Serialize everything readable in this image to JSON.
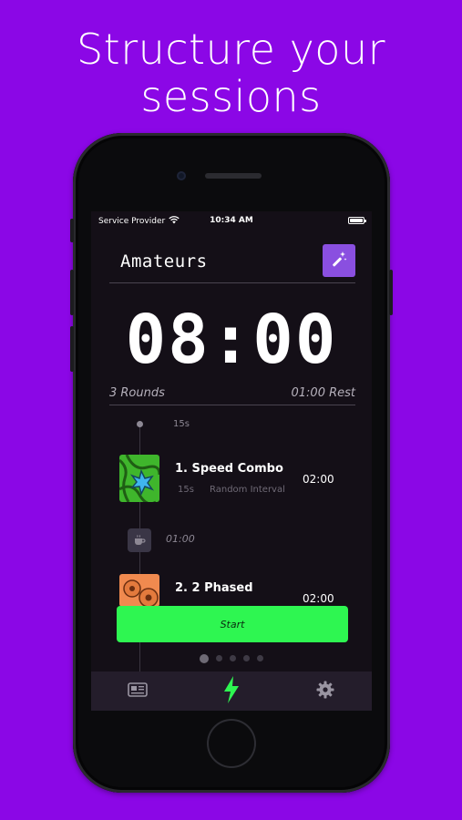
{
  "headline": {
    "line1": "Structure your",
    "line2": "sessions"
  },
  "status_bar": {
    "carrier": "Service Provider",
    "time": "10:34 AM"
  },
  "workout": {
    "title": "Amateurs",
    "timer": "08:00",
    "rounds": "3 Rounds",
    "rest": "01:00 Rest"
  },
  "timeline": {
    "prep": "15s",
    "items": [
      {
        "name": "1. Speed Combo",
        "interval": "15s",
        "mode": "Random Interval",
        "duration": "02:00"
      },
      {
        "name": "2. 2 Phased",
        "duration": "02:00"
      }
    ],
    "rest_between": "01:00"
  },
  "start_label": "Start",
  "pager": {
    "count": 5,
    "active": 0
  },
  "tabs": [
    {
      "name": "news-icon"
    },
    {
      "name": "bolt-icon",
      "active": true
    },
    {
      "name": "gear-icon"
    }
  ],
  "colors": {
    "background": "#8b07e6",
    "accent": "#8a4fe0",
    "start": "#2ef651",
    "active_tab": "#2ef651"
  }
}
